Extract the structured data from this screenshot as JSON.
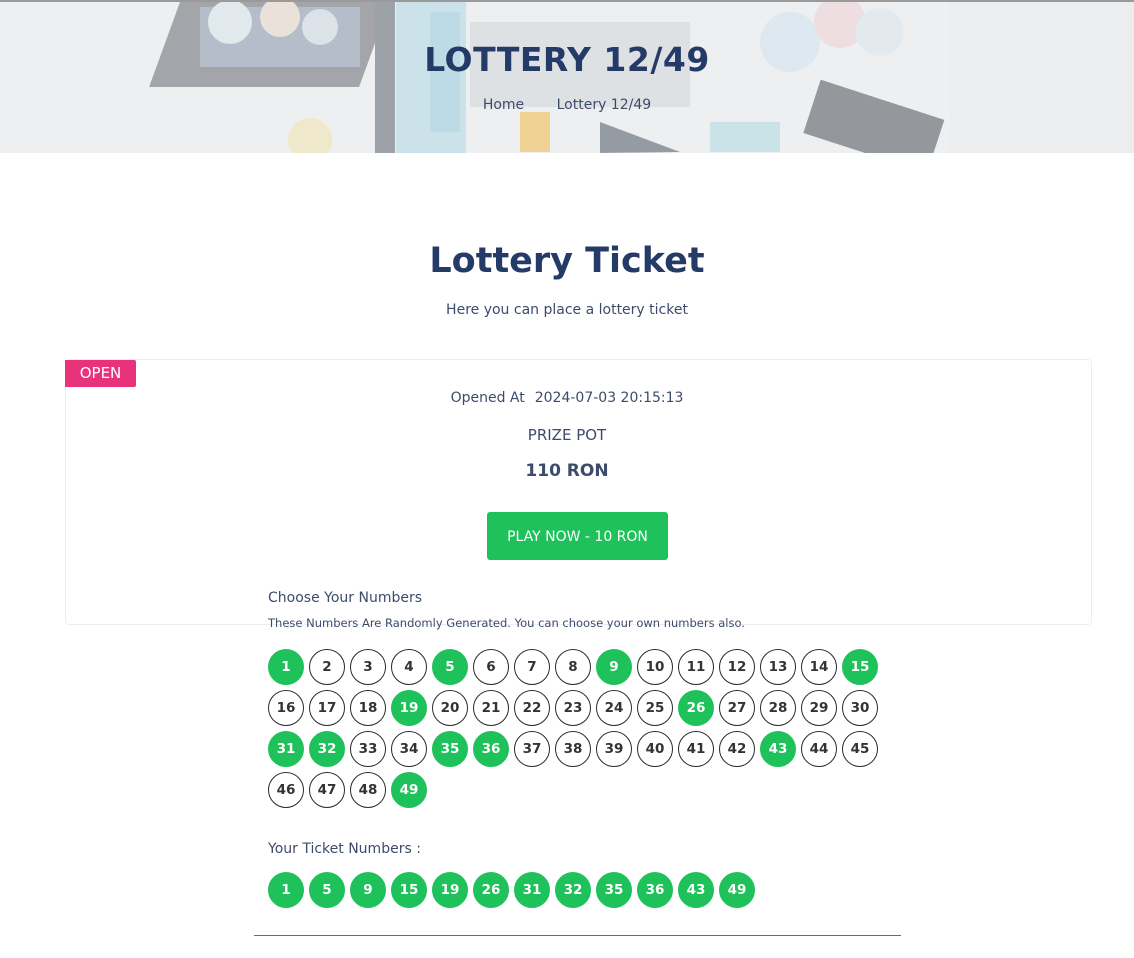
{
  "header": {
    "title": "LOTTERY 12/49",
    "breadcrumb": [
      "Home",
      "Lottery 12/49"
    ]
  },
  "section": {
    "title": "Lottery Ticket",
    "subtitle": "Here you can place a lottery ticket"
  },
  "ticket_card": {
    "status_badge": "OPEN",
    "opened_label": "Opened At",
    "opened_value": "2024-07-03 20:15:13",
    "prize_label": "PRIZE POT",
    "prize_value": "110 RON",
    "play_button_label": "PLAY NOW - 10 RON"
  },
  "number_picker": {
    "title": "Choose Your Numbers",
    "note": "These Numbers Are Randomly Generated. You can choose your own numbers also.",
    "numbers": [
      "1",
      "2",
      "3",
      "4",
      "5",
      "6",
      "7",
      "8",
      "9",
      "10",
      "11",
      "12",
      "13",
      "14",
      "15",
      "16",
      "17",
      "18",
      "19",
      "20",
      "21",
      "22",
      "23",
      "24",
      "25",
      "26",
      "27",
      "28",
      "29",
      "30",
      "31",
      "32",
      "33",
      "34",
      "35",
      "36",
      "37",
      "38",
      "39",
      "40",
      "41",
      "42",
      "43",
      "44",
      "45",
      "46",
      "47",
      "48",
      "49"
    ],
    "selected": [
      "1",
      "5",
      "9",
      "15",
      "19",
      "26",
      "31",
      "32",
      "35",
      "36",
      "43",
      "49"
    ]
  },
  "ticket_numbers": {
    "title": "Your Ticket Numbers :",
    "numbers": [
      "1",
      "5",
      "9",
      "15",
      "19",
      "26",
      "31",
      "32",
      "35",
      "36",
      "43",
      "49"
    ]
  },
  "colors": {
    "accent_green": "#1fc15a",
    "badge_pink": "#e8327a",
    "heading_navy": "#243b67"
  }
}
